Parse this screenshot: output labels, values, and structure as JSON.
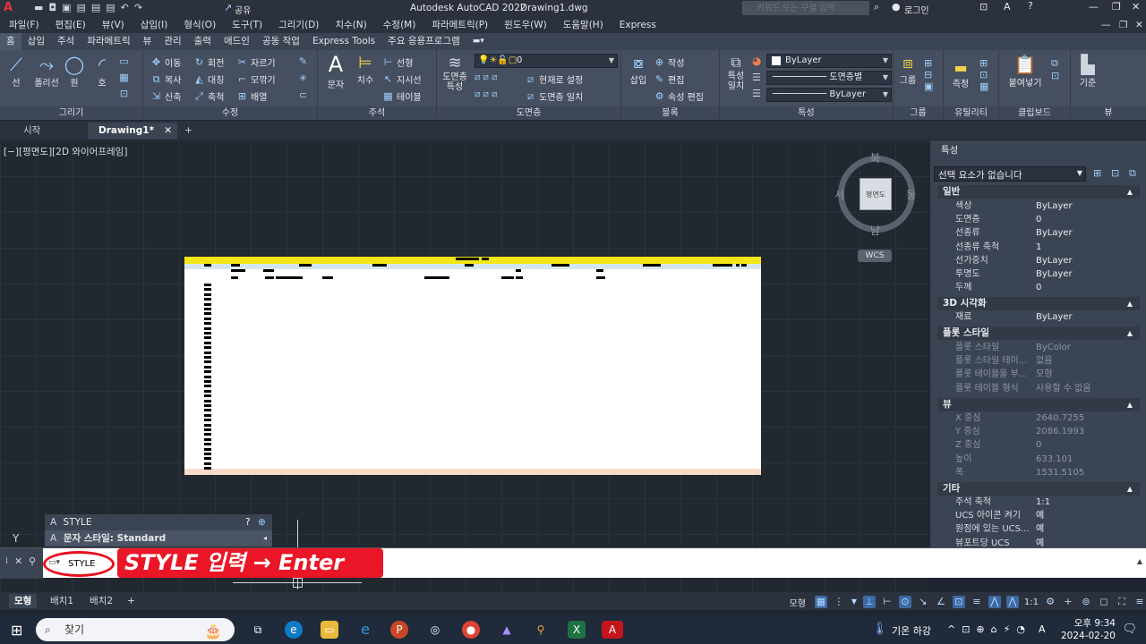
{
  "titlebar": {
    "app_title": "Autodesk AutoCAD 2022",
    "file_title": "Drawing1.dwg",
    "share_label": "공유",
    "search_placeholder": "키워드 또는 구절 입력",
    "login_label": "로그인"
  },
  "menu": [
    "파일(F)",
    "편집(E)",
    "뷰(V)",
    "삽입(I)",
    "형식(O)",
    "도구(T)",
    "그리기(D)",
    "치수(N)",
    "수정(M)",
    "파라메트릭(P)",
    "윈도우(W)",
    "도움말(H)",
    "Express"
  ],
  "ribbon_tabs": [
    "홈",
    "삽입",
    "주석",
    "파라메트릭",
    "뷰",
    "관리",
    "출력",
    "애드인",
    "공동 작업",
    "Express Tools",
    "주요 응용프로그램"
  ],
  "ribbon": {
    "draw": {
      "title": "그리기",
      "line": "선",
      "polyline": "폴리선",
      "circle": "원",
      "arc": "호"
    },
    "modify": {
      "title": "수정",
      "move": "이동",
      "rotate": "회전",
      "trim": "자르기",
      "copy": "복사",
      "mirror": "대칭",
      "fillet": "모깎기",
      "stretch": "신축",
      "scale": "축척",
      "array": "배열"
    },
    "annotation": {
      "title": "주석",
      "text": "문자",
      "dimension": "치수",
      "linear": "선형",
      "leader": "지시선",
      "table": "테이블"
    },
    "layers": {
      "title": "도면층",
      "layer_props": "도면층\n특성",
      "layer_current": "0",
      "make_current": "현재로 설정",
      "match_layer": "도면층 일치"
    },
    "block": {
      "title": "블록",
      "insert": "삽입",
      "create": "작성",
      "edit": "편집",
      "edit_attr": "속성 편집"
    },
    "properties": {
      "title": "특성",
      "match": "특성\n일치",
      "color": "ByLayer",
      "linetype_layer": "도면층별",
      "lineweight": "ByLayer"
    },
    "groups": {
      "title": "그룹",
      "group": "그룹"
    },
    "utilities": {
      "title": "유틸리티",
      "measure": "측정"
    },
    "clipboard": {
      "title": "클립보드",
      "paste": "붙여넣기"
    },
    "view": {
      "title": "뷰",
      "base": "기준"
    }
  },
  "doc_tabs": {
    "start": "시작",
    "drawing": "Drawing1*"
  },
  "viewport": {
    "label": "[−][평면도][2D 와이어프레임]",
    "compass": {
      "n": "북",
      "s": "남",
      "w": "서",
      "e": "동",
      "face": "평면도"
    },
    "wcs": "WCS",
    "axis_y": "Y"
  },
  "properties_panel": {
    "title": "특성",
    "selection": "선택 요소가 없습니다",
    "sections": {
      "general": "일반",
      "viz3d": "3D 시각화",
      "plot_style": "플롯 스타일",
      "view": "뷰",
      "misc": "기타"
    },
    "general_rows": [
      {
        "k": "색상",
        "v": "ByLayer"
      },
      {
        "k": "도면층",
        "v": "0"
      },
      {
        "k": "선종류",
        "v": "ByLayer"
      },
      {
        "k": "선종류 축척",
        "v": "1"
      },
      {
        "k": "선가중치",
        "v": "ByLayer"
      },
      {
        "k": "투명도",
        "v": "ByLayer"
      },
      {
        "k": "두께",
        "v": "0"
      }
    ],
    "viz_rows": [
      {
        "k": "재료",
        "v": "ByLayer"
      }
    ],
    "plot_rows": [
      {
        "k": "플롯 스타일",
        "v": "ByColor"
      },
      {
        "k": "플롯 스타일 테이...",
        "v": "없음"
      },
      {
        "k": "플롯 테이블을 부...",
        "v": "모형"
      },
      {
        "k": "플롯 테이블 형식",
        "v": "사용할 수 없음"
      }
    ],
    "view_rows": [
      {
        "k": "X 중심",
        "v": "2640.7255"
      },
      {
        "k": "Y 중심",
        "v": "2086.1993"
      },
      {
        "k": "Z 중심",
        "v": "0"
      },
      {
        "k": "높이",
        "v": "633.101"
      },
      {
        "k": "폭",
        "v": "1531.5105"
      }
    ],
    "misc_rows": [
      {
        "k": "주석 축척",
        "v": "1:1"
      },
      {
        "k": "UCS 아이콘 켜기",
        "v": "예"
      },
      {
        "k": "원점에 있는 UCS...",
        "v": "예"
      },
      {
        "k": "뷰포트당 UCS",
        "v": "예"
      }
    ]
  },
  "command": {
    "history_1": "STYLE",
    "history_2": "문자 스타일: Standard",
    "input": "STYLE",
    "callout": "STYLE 입력 → Enter"
  },
  "layout_tabs": [
    "모형",
    "배치1",
    "배치2"
  ],
  "status": {
    "model": "모형",
    "scale": "1:1"
  },
  "taskbar": {
    "search": "찾기",
    "weather": "기온 하강",
    "time": "오후 9:34",
    "date": "2024-02-20",
    "lang": "A"
  },
  "colors": {
    "callout": "#ea1627",
    "table_header": "#f2e616",
    "accent": "#3b6aa3"
  }
}
